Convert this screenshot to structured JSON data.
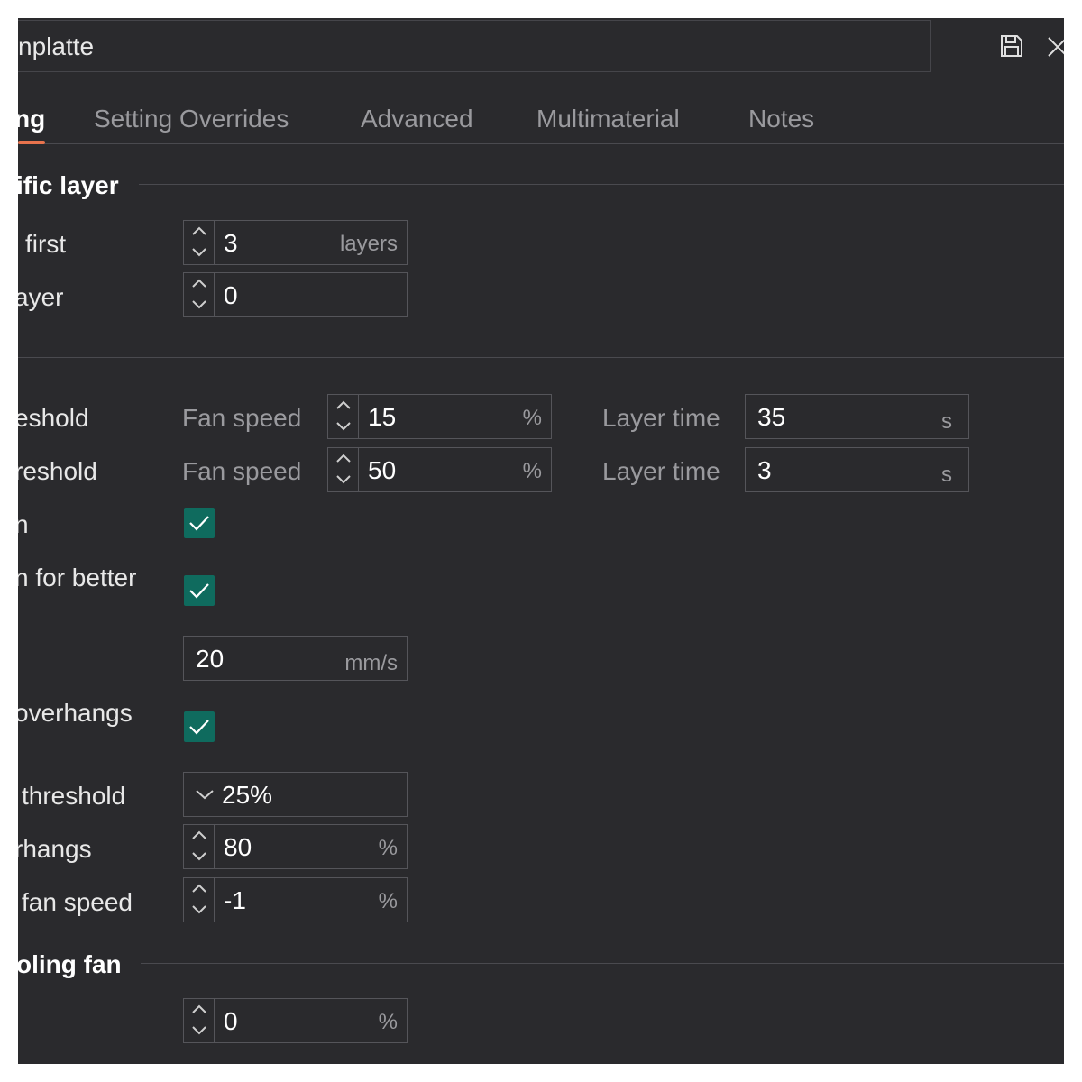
{
  "header": {
    "title": "nplatte",
    "save_icon": "save-icon",
    "close_icon": "close-icon"
  },
  "tabs": [
    {
      "label": "ng",
      "active": true
    },
    {
      "label": "Setting Overrides",
      "active": false
    },
    {
      "label": "Advanced",
      "active": false
    },
    {
      "label": "Multimaterial",
      "active": false
    },
    {
      "label": "Notes",
      "active": false
    }
  ],
  "colors": {
    "accent": "#e8734d",
    "checkbox": "#0f6b5e",
    "background": "#2a2a2d"
  },
  "sections": {
    "specific_layer": {
      "title": "ific layer",
      "rows": [
        {
          "label": "first",
          "value": "3",
          "unit": "layers"
        },
        {
          "label": "ayer",
          "value": "0",
          "unit": ""
        }
      ]
    },
    "thresholds": {
      "rows": [
        {
          "label": "eshold",
          "fan_label": "Fan speed",
          "fan_value": "15",
          "fan_unit": "%",
          "time_label": "Layer time",
          "time_value": "35",
          "time_unit": "s"
        },
        {
          "label": "reshold",
          "fan_label": "Fan speed",
          "fan_value": "50",
          "fan_unit": "%",
          "time_label": "Layer time",
          "time_value": "3",
          "time_unit": "s"
        }
      ]
    },
    "options": {
      "check1_label": "n",
      "check1_checked": true,
      "check2_label": "n for better",
      "check2_checked": true,
      "speed_value": "20",
      "speed_unit": "mm/s",
      "overhangs_label": "overhangs",
      "overhangs_checked": true,
      "threshold_label": "threshold",
      "threshold_value": "25%",
      "rhangs_label": "rhangs",
      "rhangs_value": "80",
      "rhangs_unit": "%",
      "fan_speed_label": "fan speed",
      "fan_speed_value": "-1",
      "fan_speed_unit": "%"
    },
    "cooling_fan": {
      "title": "oling fan",
      "value": "0",
      "unit": "%"
    }
  }
}
